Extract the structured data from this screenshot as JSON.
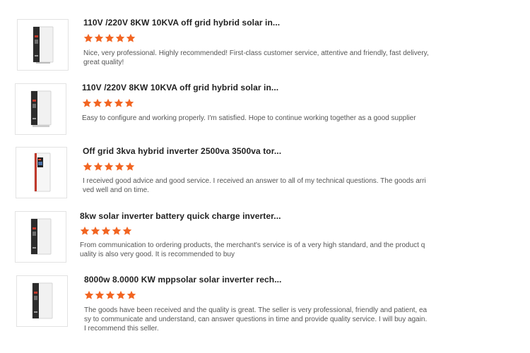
{
  "star_color": "#f26522",
  "reviews": [
    {
      "product_title": "110V /220V 8KW 10KVA off grid hybrid solar in...",
      "rating": 5,
      "product_icon": "inverter-product-icon",
      "comment": "Nice, very professional. Highly recommended! First-class customer service, attentive and friendly, fast delivery, great quality!"
    },
    {
      "product_title": "110V /220V 8KW 10KVA off grid hybrid solar in...",
      "rating": 5,
      "product_icon": "inverter-product-icon",
      "comment": "Easy to configure and working properly. I'm satisfied. Hope to continue working together as a good supplier"
    },
    {
      "product_title": "Off grid 3kva hybrid inverter 2500va 3500va tor...",
      "rating": 5,
      "product_icon": "inverter-product-icon",
      "comment": "I received good advice and good service. I received an answer to all of my technical questions. The goods arrived well and on time."
    },
    {
      "product_title": "8kw solar inverter battery quick charge inverter...",
      "rating": 5,
      "product_icon": "inverter-product-icon",
      "comment": "From communication to ordering products, the merchant's service is of a very high standard, and the product quality is also very good. It is recommended to buy"
    },
    {
      "product_title": "8000w 8.0000 KW mppsolar solar inverter rech...",
      "rating": 5,
      "product_icon": "inverter-product-icon",
      "comment": "The goods have been received and the quality is great. The seller is very professional, friendly and patient, easy to communicate and understand, can answer questions in time and provide quality service. I will buy again. I recommend this seller."
    }
  ]
}
